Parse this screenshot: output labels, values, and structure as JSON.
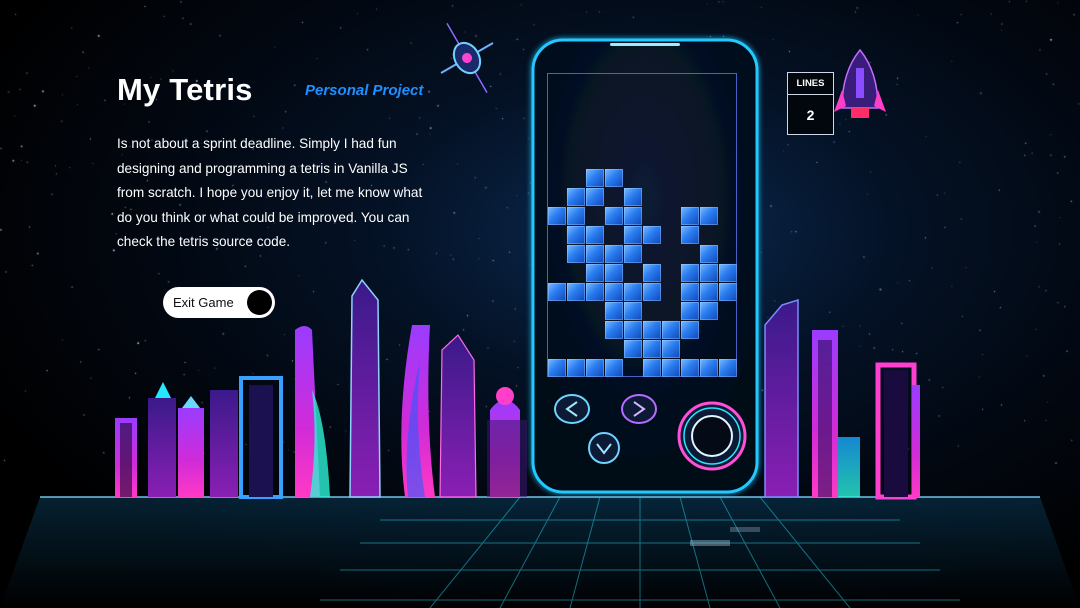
{
  "header": {
    "title": "My Tetris",
    "subtitle": "Personal Project"
  },
  "description": "Is not about a sprint deadline. Simply I had fun designing and programming a tetris in Vanilla JS from scratch. I hope you enjoy it, let me know what do you think or what could be improved. You can check the tetris source code.",
  "exit_toggle": {
    "label": "Exit Game",
    "on": true
  },
  "score": {
    "label": "LINES",
    "value": "2"
  },
  "board": {
    "columns": 10,
    "rows": 16,
    "filled_cells": [
      [
        2,
        5
      ],
      [
        3,
        5
      ],
      [
        1,
        6
      ],
      [
        2,
        6
      ],
      [
        4,
        6
      ],
      [
        0,
        7
      ],
      [
        1,
        7
      ],
      [
        3,
        7
      ],
      [
        4,
        7
      ],
      [
        7,
        7
      ],
      [
        8,
        7
      ],
      [
        1,
        8
      ],
      [
        2,
        8
      ],
      [
        4,
        8
      ],
      [
        5,
        8
      ],
      [
        7,
        8
      ],
      [
        1,
        9
      ],
      [
        2,
        9
      ],
      [
        3,
        9
      ],
      [
        4,
        9
      ],
      [
        8,
        9
      ],
      [
        2,
        10
      ],
      [
        3,
        10
      ],
      [
        5,
        10
      ],
      [
        7,
        10
      ],
      [
        8,
        10
      ],
      [
        9,
        10
      ],
      [
        0,
        11
      ],
      [
        1,
        11
      ],
      [
        2,
        11
      ],
      [
        3,
        11
      ],
      [
        4,
        11
      ],
      [
        5,
        11
      ],
      [
        7,
        11
      ],
      [
        8,
        11
      ],
      [
        9,
        11
      ],
      [
        3,
        12
      ],
      [
        4,
        12
      ],
      [
        7,
        12
      ],
      [
        8,
        12
      ],
      [
        3,
        13
      ],
      [
        4,
        13
      ],
      [
        5,
        13
      ],
      [
        6,
        13
      ],
      [
        7,
        13
      ],
      [
        4,
        14
      ],
      [
        5,
        14
      ],
      [
        6,
        14
      ],
      [
        0,
        15
      ],
      [
        1,
        15
      ],
      [
        2,
        15
      ],
      [
        3,
        15
      ],
      [
        5,
        15
      ],
      [
        6,
        15
      ],
      [
        7,
        15
      ],
      [
        8,
        15
      ],
      [
        9,
        15
      ]
    ]
  },
  "colors": {
    "accent": "#1e90ff",
    "block": "#2a7df0",
    "board_border": "#4a62c8",
    "phone_glow": "#21c8ff",
    "neon_pink": "#ff2fd8",
    "neon_cyan": "#27e6ff"
  },
  "icons": {
    "left": "chevron-left-icon",
    "right": "chevron-right-icon",
    "down": "chevron-down-icon",
    "rotate": "circle-icon"
  }
}
